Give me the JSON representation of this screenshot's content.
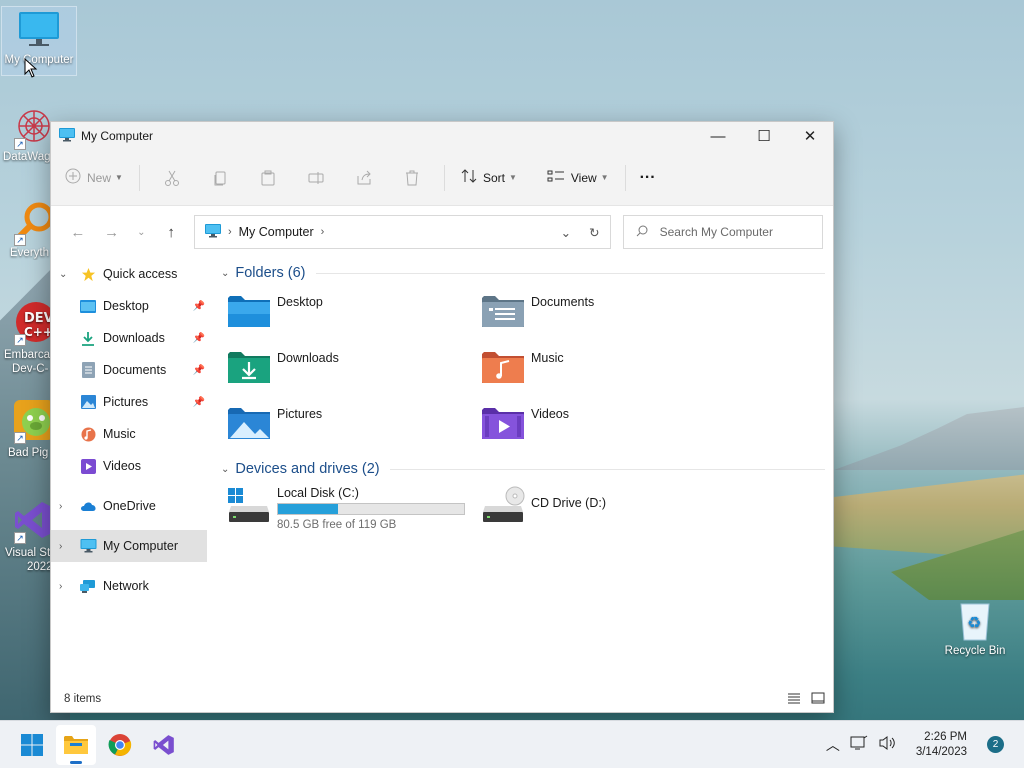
{
  "desktop": {
    "icons": [
      {
        "label": "My Computer"
      },
      {
        "label": "DataWag"
      },
      {
        "label": "Everyth"
      },
      {
        "label": "Embarca Dev-C++",
        "line1": "Embarca",
        "line2": "Dev-C-"
      },
      {
        "label": "Bad Pig"
      },
      {
        "label": "Visual St 2022",
        "line1": "Visual St",
        "line2": "2022"
      },
      {
        "label": "Recycle Bin"
      }
    ]
  },
  "window": {
    "title": "My Computer",
    "controls": {
      "minimize": "—",
      "maximize": "☐",
      "close": "✕"
    },
    "toolbar": {
      "new_label": "New",
      "sort_label": "Sort",
      "view_label": "View",
      "more_label": "···"
    },
    "address": {
      "location": "My Computer"
    },
    "search": {
      "placeholder": "Search My Computer"
    },
    "nav": {
      "quick_access": "Quick access",
      "pinned": [
        {
          "label": "Desktop",
          "icon": "desktop-folder-icon",
          "pinned": true
        },
        {
          "label": "Downloads",
          "icon": "downloads-icon",
          "pinned": true
        },
        {
          "label": "Documents",
          "icon": "documents-icon",
          "pinned": true
        },
        {
          "label": "Pictures",
          "icon": "pictures-icon",
          "pinned": true
        },
        {
          "label": "Music",
          "icon": "music-icon",
          "pinned": false
        },
        {
          "label": "Videos",
          "icon": "videos-icon",
          "pinned": false
        }
      ],
      "onedrive": "OneDrive",
      "my_computer": "My Computer",
      "network": "Network"
    },
    "folders": {
      "heading": "Folders (6)",
      "items": [
        {
          "label": "Desktop",
          "color": "#1e8fdc"
        },
        {
          "label": "Documents",
          "color": "#7a93a8"
        },
        {
          "label": "Downloads",
          "color": "#1aa37f"
        },
        {
          "label": "Music",
          "color": "#e8734a"
        },
        {
          "label": "Pictures",
          "color": "#2b86d6"
        },
        {
          "label": "Videos",
          "color": "#7b4bd2"
        }
      ]
    },
    "drives": {
      "heading": "Devices and drives (2)",
      "items": [
        {
          "label": "Local Disk (C:)",
          "free_text": "80.5 GB free of 119 GB",
          "used_fraction": 0.32
        },
        {
          "label": "CD Drive (D:)"
        }
      ]
    },
    "status": {
      "items_count": "8 items"
    }
  },
  "taskbar": {
    "time": "2:26 PM",
    "date": "3/14/2023",
    "notification_count": "2"
  }
}
